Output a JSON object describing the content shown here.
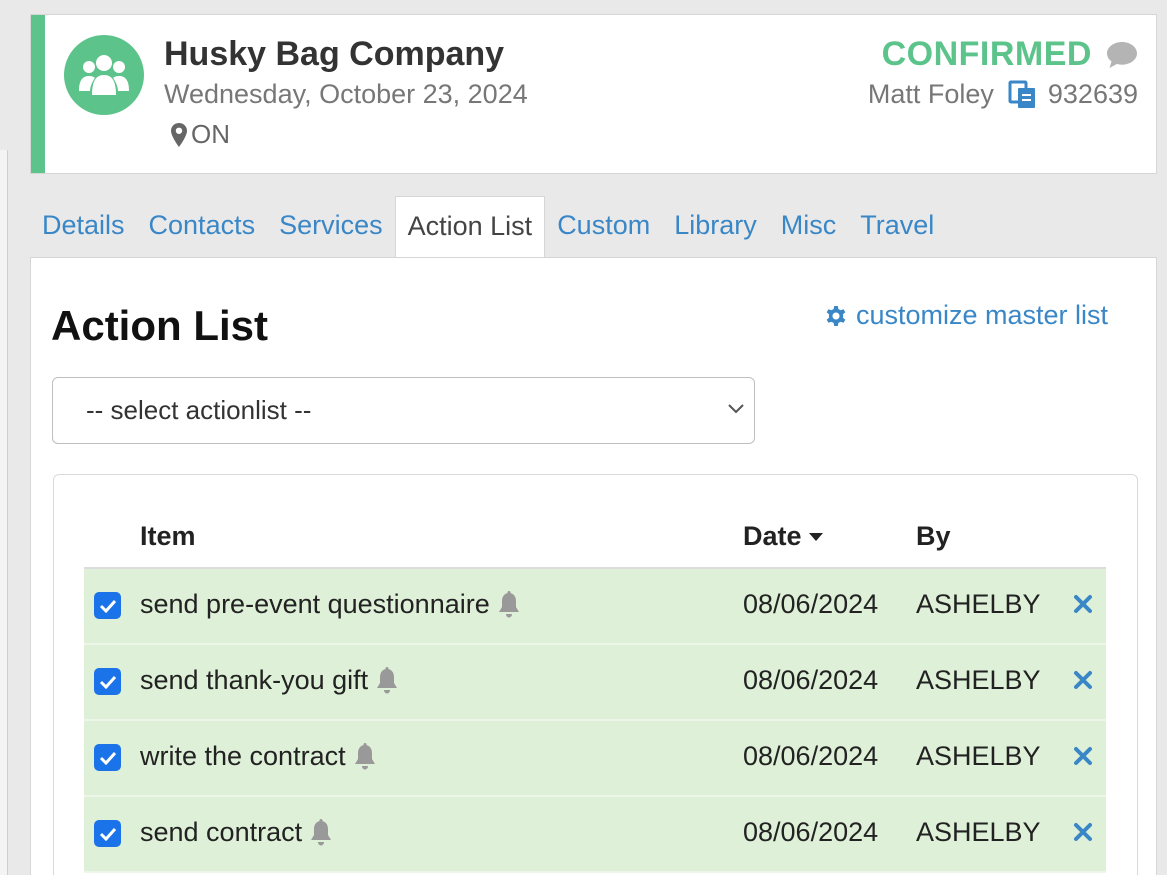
{
  "header": {
    "company": "Husky Bag Company",
    "date": "Wednesday, October 23, 2024",
    "location": "ON",
    "status": "CONFIRMED",
    "contact": "Matt Foley",
    "doc_number": "932639",
    "accent_color": "#5cc38a"
  },
  "tabs": [
    {
      "label": "Details"
    },
    {
      "label": "Contacts"
    },
    {
      "label": "Services"
    },
    {
      "label": "Action List",
      "active": true
    },
    {
      "label": "Custom"
    },
    {
      "label": "Library"
    },
    {
      "label": "Misc"
    },
    {
      "label": "Travel"
    }
  ],
  "panel": {
    "title": "Action List",
    "customize_label": "customize master list",
    "select_value": "-- select actionlist --"
  },
  "table": {
    "columns": {
      "item": "Item",
      "date": "Date",
      "by": "By"
    },
    "rows": [
      {
        "item": "send pre-event questionnaire",
        "date": "08/06/2024",
        "by": "ASHELBY",
        "checked": true
      },
      {
        "item": "send thank-you gift",
        "date": "08/06/2024",
        "by": "ASHELBY",
        "checked": true
      },
      {
        "item": "write the contract",
        "date": "08/06/2024",
        "by": "ASHELBY",
        "checked": true
      },
      {
        "item": "send contract",
        "date": "08/06/2024",
        "by": "ASHELBY",
        "checked": true
      }
    ]
  },
  "icons": {
    "avatar": "users-group-icon",
    "location": "map-pin-icon",
    "comment": "comment-icon",
    "document": "documents-icon",
    "gear": "gear-icon",
    "bell": "bell-icon",
    "delete": "close-icon",
    "sort": "caret-down-icon"
  }
}
